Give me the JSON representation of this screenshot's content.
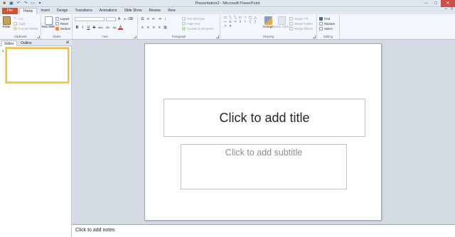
{
  "window": {
    "title": "Presentation2 - Microsoft PowerPoint",
    "qat": [
      "save-icon",
      "undo-icon",
      "redo-icon",
      "start-slideshow-icon",
      "customize-icon"
    ],
    "controls": {
      "minimize": "–",
      "maximize": "□",
      "close": "✕"
    }
  },
  "tabs": [
    "File",
    "Home",
    "Insert",
    "Design",
    "Transitions",
    "Animations",
    "Slide Show",
    "Review",
    "View"
  ],
  "active_tab": "Home",
  "ribbon": {
    "clipboard": {
      "label": "Clipboard",
      "paste": "Paste",
      "cut": "Cut",
      "copy": "Copy",
      "format_painter": "Format Painter"
    },
    "slides": {
      "label": "Slides",
      "new_slide": "New Slide",
      "layout": "Layout",
      "reset": "Reset",
      "section": "Section"
    },
    "font": {
      "label": "Font",
      "bold": "B",
      "italic": "I",
      "underline": "U",
      "strike": "S",
      "shadow": "abc",
      "spacing": "AV",
      "case": "Aa",
      "color": "A",
      "grow": "A",
      "shrink": "A"
    },
    "paragraph": {
      "label": "Paragraph",
      "text_direction": "Text Direction",
      "align_text": "Align Text",
      "convert_smartart": "Convert to SmartArt"
    },
    "drawing": {
      "label": "Drawing",
      "arrange": "Arrange",
      "quick_styles": "Quick Styles",
      "shape_fill": "Shape Fill",
      "shape_outline": "Shape Outline",
      "shape_effects": "Shape Effects"
    },
    "editing": {
      "label": "Editing",
      "find": "Find",
      "replace": "Replace",
      "select": "Select"
    }
  },
  "slides_pane": {
    "tab_slides": "Slides",
    "tab_outline": "Outline",
    "close": "✕",
    "thumb_number": "1"
  },
  "slide": {
    "title_placeholder": "Click to add title",
    "subtitle_placeholder": "Click to add subtitle"
  },
  "notes": {
    "placeholder": "Click to add notes"
  },
  "colors": {
    "file_tab": "#d4502f",
    "thumb_border": "#f0c044",
    "ribbon_bg": "#f3f6fa",
    "workspace_bg": "#d5dbe5"
  }
}
